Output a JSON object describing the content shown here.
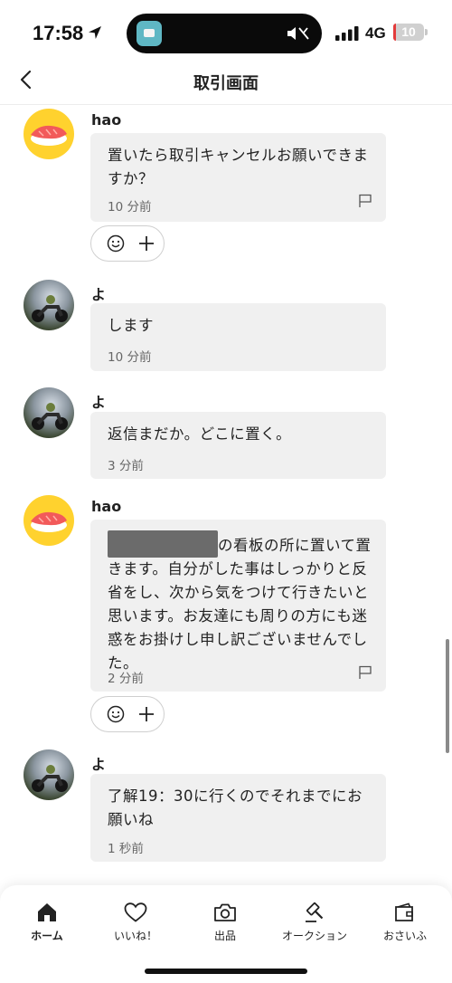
{
  "status_bar": {
    "time": "17:58",
    "network": "4G",
    "battery": "10"
  },
  "header": {
    "title": "取引画面"
  },
  "messages": [
    {
      "sender": "hao",
      "avatar": "sushi-avatar",
      "text": "置いたら取引キャンセルお願いできますか？",
      "ago": "10 分前",
      "has_flag": true,
      "has_reactions": true
    },
    {
      "sender": "よ",
      "avatar": "motorcycle-photo-avatar",
      "text": "します",
      "ago": "10 分前"
    },
    {
      "sender": "よ",
      "avatar": "motorcycle-photo-avatar",
      "text": "返信まだか。どこに置く。",
      "ago": "3 分前"
    },
    {
      "sender": "hao",
      "avatar": "sushi-avatar",
      "text": "の看板の所に置いて置きます。自分がした事はしっかりと反省をし、次から気をつけて行きたいと思います。お友達にも周りの方にも迷惑をお掛けし申し訳ございませんでした。",
      "ago": "2 分前",
      "has_flag": true,
      "has_reactions": true
    },
    {
      "sender": "よ",
      "avatar": "motorcycle-photo-avatar",
      "text": "了解19：30に行くのでそれまでにお願いね",
      "ago": "1 秒前"
    }
  ],
  "tabs": [
    {
      "label": "ホーム",
      "icon": "home-icon",
      "active": true
    },
    {
      "label": "いいね！",
      "icon": "heart-icon"
    },
    {
      "label": "出品",
      "icon": "camera-icon"
    },
    {
      "label": "オークション",
      "icon": "gavel-icon"
    },
    {
      "label": "おさいふ",
      "icon": "wallet-icon"
    }
  ],
  "colors": {
    "accent_active_tab": "#222222",
    "bubble": "#f0f0f0",
    "avatar_yellow": "#ffd22e",
    "battery_low": "#e33b3b"
  }
}
